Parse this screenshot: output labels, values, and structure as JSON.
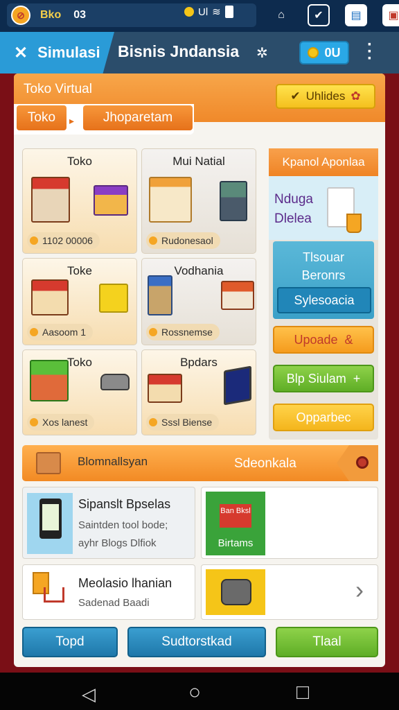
{
  "status_bar": {
    "app_text": "Bko",
    "counter": "03",
    "signal_text": "Ul",
    "colors": {
      "bg": "#0d2b4e",
      "accent": "#f5d04a"
    }
  },
  "header": {
    "back_label": "Simulasi",
    "title": "Bisnis Jndansia",
    "coins": "0U"
  },
  "panel": {
    "title": "Toko Virtual",
    "tabs": [
      "Toko",
      "Jhoparetam"
    ],
    "action_button": "Uhlides"
  },
  "cards": [
    {
      "title": "Toko",
      "pill": "1102 00006"
    },
    {
      "title": "Mui Natial",
      "pill": "Rudonesaol"
    },
    {
      "title": "Toke",
      "pill": "Aasoom 1"
    },
    {
      "title": "Vodhania",
      "pill": "Rossnemse"
    },
    {
      "title": "Toko",
      "pill": "Xos lanest"
    },
    {
      "title": "Bpdars",
      "pill": "Sssl Biense"
    }
  ],
  "side_panel": {
    "header": "Kpanol Aponlaa",
    "promo_lines": [
      "Nduga",
      "Dlelea"
    ],
    "box_lines": [
      "Tlsouar",
      "Beronrs"
    ],
    "box_button": "Sylesoacia",
    "buttons": [
      {
        "label": "Upoade",
        "extra": "&"
      },
      {
        "label": "Blp Siulam",
        "extra": "+"
      },
      {
        "label": "Opparbec",
        "extra": ""
      }
    ]
  },
  "section_bar": {
    "left": "Blomnallsyan",
    "right": "Sdeonkala"
  },
  "list": [
    {
      "title": "Sipanslt Bpselas",
      "lines": [
        "Saintden tool bode;",
        "ayhr Blogs Dlfiok"
      ]
    },
    {
      "badge_top": "Ban Bksl",
      "badge_bottom": "Birtams"
    },
    {
      "title": "Meolasio lhanian",
      "lines": [
        "Sadenad Baadi"
      ]
    },
    {
      "arrow": "›"
    }
  ],
  "footer_buttons": [
    "Topd",
    "Sudtorstkad",
    "Tlaal"
  ],
  "nav": {
    "back": "◁",
    "home": "○",
    "recent": "□"
  }
}
